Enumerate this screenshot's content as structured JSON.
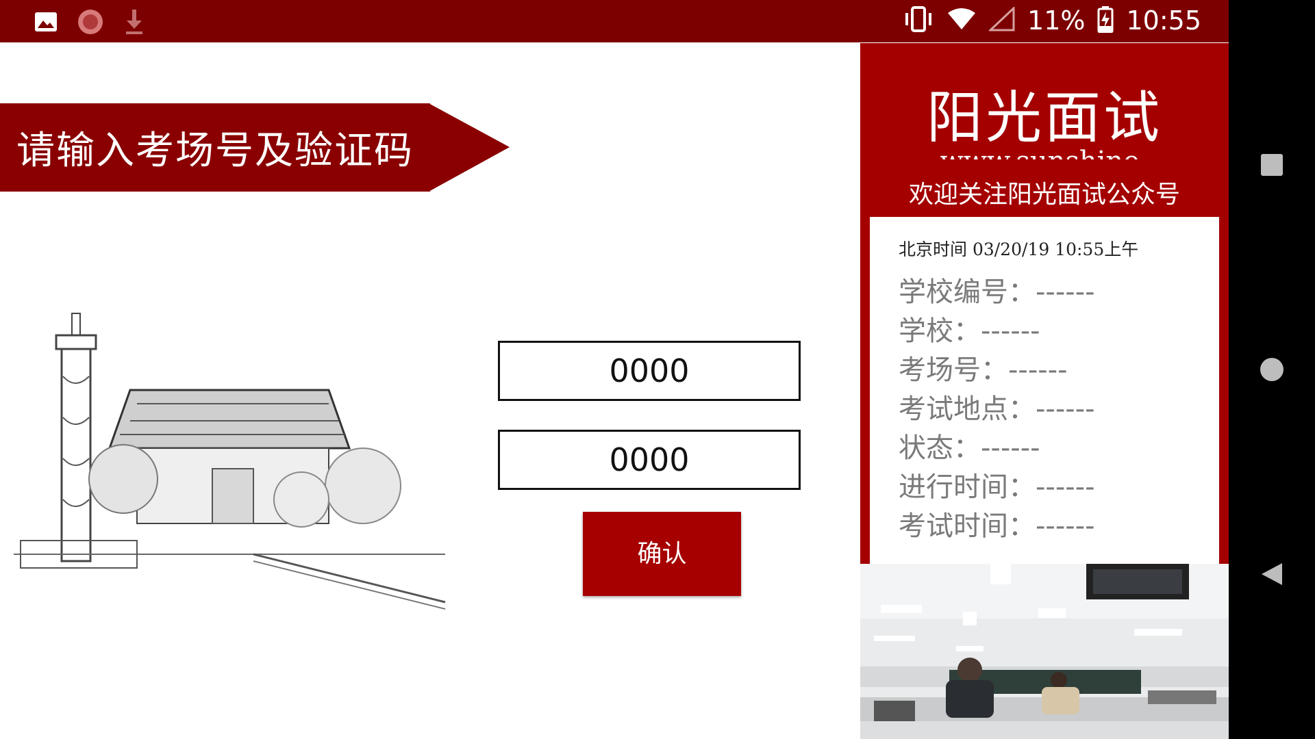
{
  "status_bar": {
    "icons": [
      "image-icon",
      "circle-app-icon",
      "download-icon",
      "vibrate-icon",
      "wifi-icon",
      "signal-icon",
      "battery-charging-icon"
    ],
    "battery": "11%",
    "time": "10:55"
  },
  "nav_bar": {
    "icons": [
      "recents-icon",
      "home-icon",
      "back-icon"
    ]
  },
  "banner": {
    "text": "请输入考场号及验证码"
  },
  "form": {
    "room_value": "0000",
    "code_value": "0000",
    "confirm_label": "确认"
  },
  "panel": {
    "title": "阳光面试",
    "url": "www.sunshine-",
    "subtitle": "欢迎关注阳光面试公众号",
    "time_text": "北京时间 03/20/19 10:55上午",
    "info": [
      "学校编号：------",
      "学校：------",
      "考场号：------",
      "考试地点：------",
      "状态：------",
      "进行时间：------",
      "考试时间：------"
    ]
  },
  "colors": {
    "status_bar": "#7d0000",
    "accent": "#a40000",
    "banner": "#8a0000",
    "button": "#a60000"
  }
}
